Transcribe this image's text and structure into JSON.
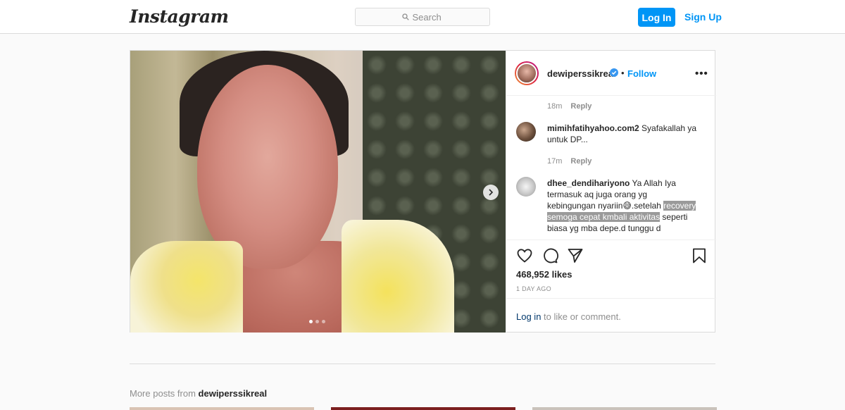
{
  "header": {
    "logo": "Instagram",
    "search_placeholder": "Search",
    "login_label": "Log In",
    "signup_label": "Sign Up"
  },
  "post": {
    "username": "dewiperssikreal",
    "verified": true,
    "separator": "•",
    "follow_label": "Follow",
    "more_label": "•••",
    "carousel": {
      "slides": 3,
      "active": 0
    },
    "comments": [
      {
        "username": "",
        "text": "",
        "time": "18m",
        "reply": "Reply"
      },
      {
        "username": "mimihfatihyahoo.com2",
        "text": "Syafakallah ya untuk DP...",
        "time": "17m",
        "reply": "Reply"
      },
      {
        "username": "dhee_dendihariyono",
        "text_part1": "Ya Allah Iya termasuk aq juga orang yg kebingungan nyariin😅.setelah",
        "text_highlight": "recovery semoga cepat kmbali aktivitas",
        "text_part2": "seperti biasa yg mba depe.d tunggu d"
      }
    ],
    "likes": "468,952 likes",
    "posted": "1 DAY AGO",
    "login_link": "Log in",
    "login_suffix": " to like or comment."
  },
  "more_posts": {
    "prefix": "More posts from ",
    "username": "dewiperssikreal"
  },
  "colors": {
    "accent": "#0095f6",
    "border": "#dbdbdb",
    "background": "#fafafa",
    "muted": "#8e8e8e"
  },
  "icons": [
    "search-icon",
    "verified-badge-icon",
    "more-options-icon",
    "chevron-right-icon",
    "heart-icon",
    "comment-icon",
    "share-icon",
    "bookmark-icon"
  ]
}
